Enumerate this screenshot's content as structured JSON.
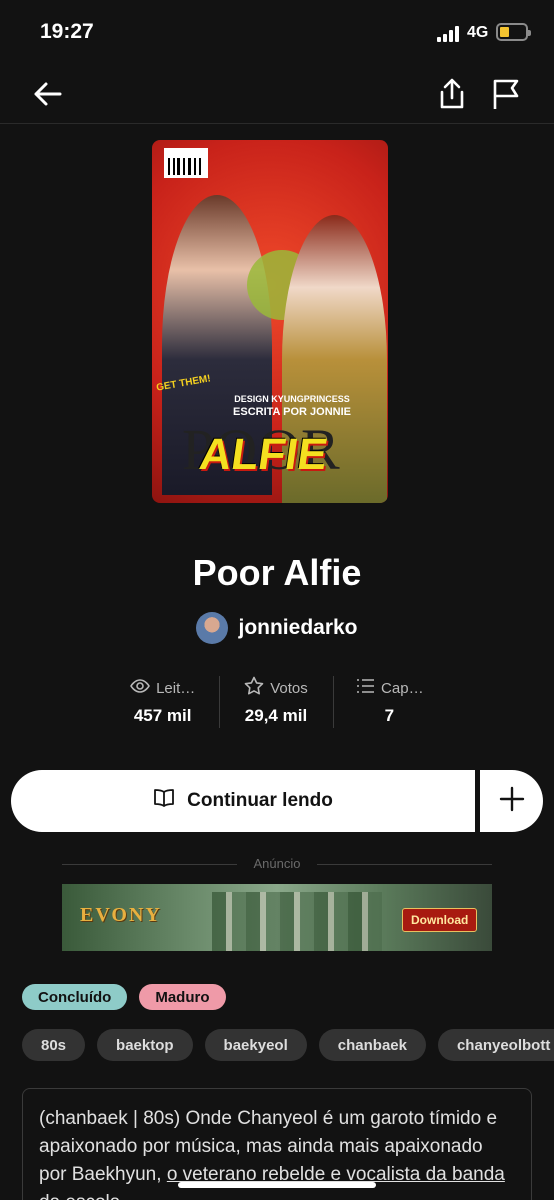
{
  "status_bar": {
    "time": "19:27",
    "network": "4G"
  },
  "nav": {
    "back_icon": "arrow-left-icon",
    "share_icon": "share-icon",
    "flag_icon": "flag-icon"
  },
  "cover": {
    "get_them": "GET THEM!",
    "credit_design": "DESIGN KYUNGPRINCESS",
    "credit_writer": "ESCRITA POR JONNIE",
    "poor": "POOR",
    "alfie": "ALFIE"
  },
  "story": {
    "title": "Poor Alfie",
    "author": "jonniedarko"
  },
  "stats": [
    {
      "icon": "eye-icon",
      "label": "Leit…",
      "value": "457 mil"
    },
    {
      "icon": "star-icon",
      "label": "Votos",
      "value": "29,4 mil"
    },
    {
      "icon": "list-icon",
      "label": "Cap…",
      "value": "7"
    }
  ],
  "actions": {
    "continue_label": "Continuar lendo",
    "add_icon": "plus-icon"
  },
  "ad": {
    "label": "Anúncio",
    "logo": "EVONY",
    "cta": "Download"
  },
  "status_tags": {
    "completed": "Concluído",
    "mature": "Maduro"
  },
  "tags": [
    "80s",
    "baektop",
    "baekyeol",
    "chanbaek",
    "chanyeolbott"
  ],
  "description": {
    "part1": "(chanbaek | 80s) Onde Chanyeol é um garoto tímido e apaixonado por música, mas ainda mais apaixonado por Baekhyun, ",
    "part2": "o veterano rebelde e vocalista da banda da escola."
  },
  "colors": {
    "background": "#121212",
    "completed_pill": "#8ecbc8",
    "mature_pill": "#ef9aa8"
  }
}
